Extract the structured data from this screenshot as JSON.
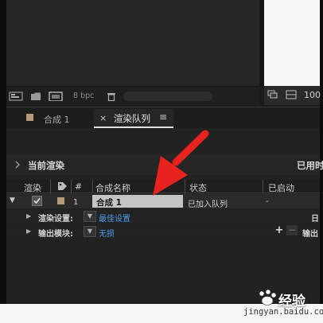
{
  "project_footer": {
    "bpc": "8 bpc"
  },
  "viewer": {
    "zoom": "100"
  },
  "tabs": [
    {
      "label": "合成 1",
      "active": false
    },
    {
      "label": "渲染队列",
      "active": true
    }
  ],
  "tab_close": "×",
  "tab_menu": "≡",
  "current_render": {
    "label": "当前渲染",
    "elapsed_label": "已用时"
  },
  "columns": {
    "render": "渲染",
    "number": "#",
    "comp_name": "合成名称",
    "status": "状态",
    "started": "已启动"
  },
  "render_item": {
    "number": "1",
    "comp_name": "合成 1",
    "status": "已加入队列",
    "started": "-",
    "checked": true
  },
  "render_settings": {
    "label": "渲染设置:",
    "value": "最佳设置",
    "right": "日"
  },
  "output_module": {
    "label": "输出模块:",
    "value": "无损",
    "right": "输出"
  },
  "buttons": {
    "plus": "+",
    "minus": "−"
  },
  "watermark": {
    "brand": "经验",
    "url": "jingyan.baidu.com"
  },
  "colors": {
    "accent_link": "#4e9bea",
    "arrow": "#e8231f",
    "label_swatch": "#b59a7a"
  }
}
